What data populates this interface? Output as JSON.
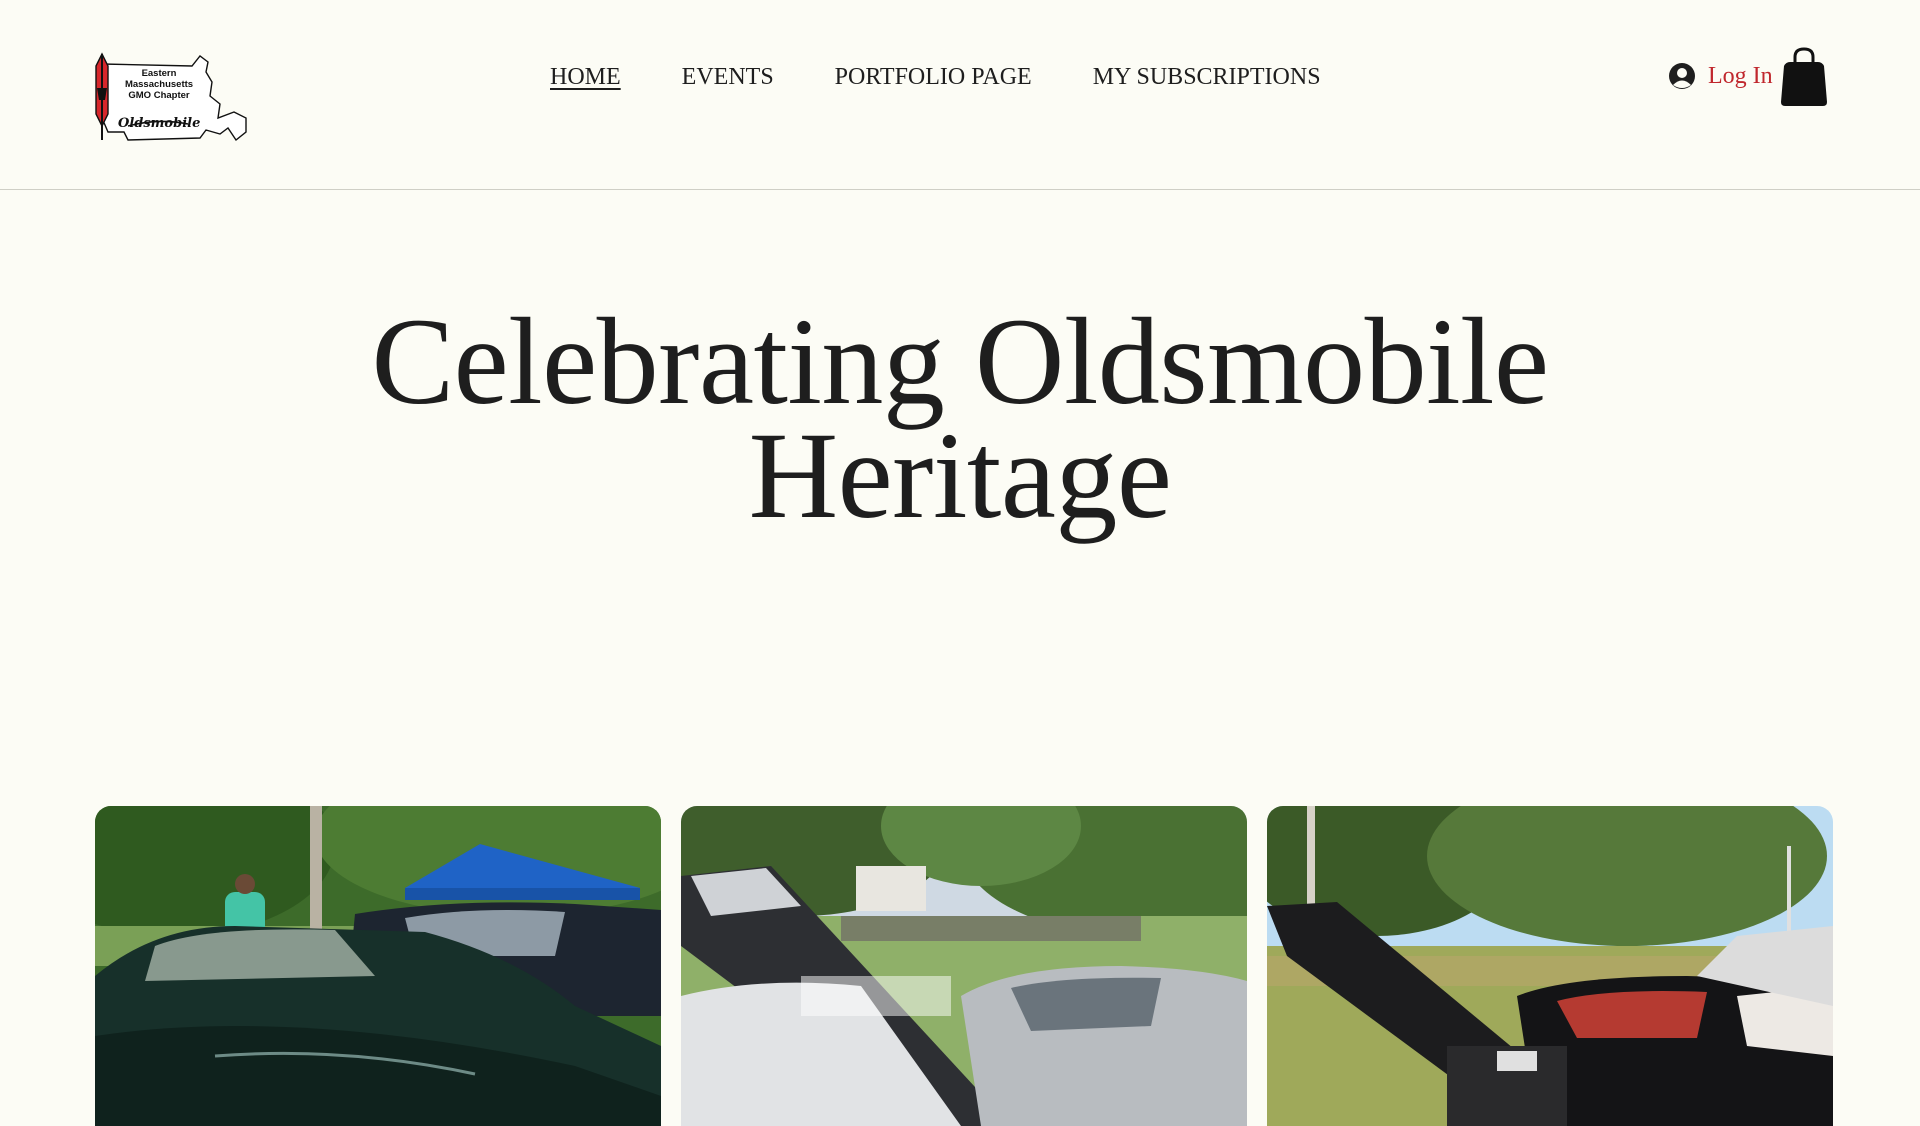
{
  "header": {
    "logo": {
      "lines": [
        "Eastern",
        "Massachusetts",
        "GMO Chapter"
      ],
      "script": "Oldsmobile",
      "icon": "oldsmobile-rocket-emblem-icon"
    },
    "nav": [
      {
        "label": "HOME",
        "active": true
      },
      {
        "label": "EVENTS",
        "active": false
      },
      {
        "label": "PORTFOLIO PAGE",
        "active": false
      },
      {
        "label": "MY SUBSCRIPTIONS",
        "active": false
      }
    ],
    "login": {
      "label": "Log In",
      "icon": "user-avatar-icon"
    },
    "cart": {
      "icon": "shopping-bag-icon"
    }
  },
  "hero": {
    "title_line1": "Celebrating Oldsmobile",
    "title_line2": "Heritage"
  },
  "gallery": {
    "images": [
      {
        "name": "green-oldsmobile-car-show-photo"
      },
      {
        "name": "silver-oldsmobile-open-hood-photo"
      },
      {
        "name": "black-oldsmobile-open-hood-photo"
      }
    ]
  },
  "colors": {
    "background": "#fcfcf5",
    "text": "#1e1e1e",
    "accent": "#c0272d",
    "divider": "#cfcfc6"
  }
}
